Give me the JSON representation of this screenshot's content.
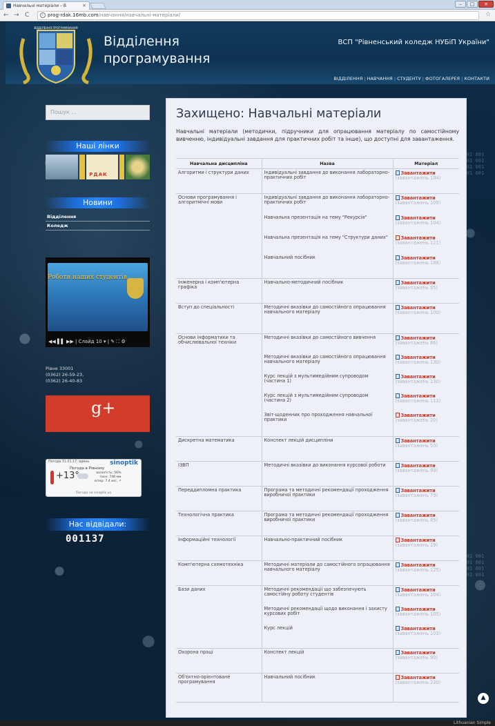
{
  "browser": {
    "tab_title": "Навчальні матеріали – В",
    "tab_close": "×",
    "url_host": "prog-rdak.16mb.com",
    "url_path": "/навчання/навчальні-матеріали/",
    "back": "←",
    "forward": "→",
    "reload": "C",
    "star": "☆"
  },
  "header": {
    "site_title_line1": "Відділення",
    "site_title_line2": "програмування",
    "college": "ВСП \"Рівненський коледж НУБіП України\"",
    "nav": [
      "ВІДДІЛЕННЯ",
      "НАВЧАННЯ",
      "СТУДЕНТУ",
      "ФОТОГАЛЕРЕЯ",
      "КОНТАКТИ"
    ],
    "logo_text": "ВІДДІЛЕННЯ ПРОГРАМУВАННЯ"
  },
  "sidebar": {
    "search_placeholder": "Пошук ...",
    "links_title": "Наші лінки",
    "links_logo_text": "РДАК",
    "news_title": "Новини",
    "news_items": [
      "Відділення",
      "Коледж"
    ],
    "video_slide_text": "Роботи наших студентів",
    "video_controls": "◀◀  ▌▌  ▶▶  | Слайд 10 ▾ |  ✎  ⛶  ⚙",
    "address_lines": [
      "Рівне 33001",
      "(0362) 26-59-23,",
      "(0362) 26-40-83"
    ],
    "gplus_label": "g+",
    "weather": {
      "header": "Погода 31.01.17, вдень",
      "brand": "sinoptik",
      "city": "Погода в Рівному",
      "temp": "+13°",
      "details": "вологість: 56%\nтиск: 748 мм\nвітер: 7.4 м/с, ↗",
      "footer": "Погода на sinoptik.ua"
    },
    "visits_title": "Нас відвідали:",
    "visits_count": "001137"
  },
  "content": {
    "title": "Захищено: Навчальні матеріали",
    "intro": "Навчальні матеріали (методички, підручники для опрацювання матеріалу по самостійному вивченню, індивідуальні завдання для практичних робіт та інше), що доступні для завантаження.",
    "columns": [
      "Навчальна дисципліна",
      "Назва",
      "Матеріал"
    ],
    "download_label": "Завантажити",
    "rows": [
      {
        "discipline": "Алгоритми і структури даних",
        "items": [
          {
            "title": "Індивідуальні завдання до виконання лабораторно-практичних робіт",
            "count": "(завантажень 194)",
            "icon": "word"
          }
        ]
      },
      {
        "discipline": "Основи програмування і алгоритмічні мови",
        "items": [
          {
            "title": "Індивідуальні завдання до виконання лабораторно-практичних робіт",
            "count": "(завантажень 109)",
            "icon": "word"
          },
          {
            "title": "Навчальна презентація на тему \"Рекурсія\"",
            "count": "(завантажень 104)",
            "icon": "word"
          },
          {
            "title": "Навчальна презентація на тему \"Структури даних\"",
            "count": "(завантажень 121)",
            "icon": "ppt"
          },
          {
            "title": "Навчальний посібник",
            "count": "(завантажень 188)",
            "icon": "word"
          }
        ]
      },
      {
        "discipline": "Інженерна і комп'ютерна графіка",
        "items": [
          {
            "title": "Навчально-методичний посібник",
            "count": "(завантажень 95)",
            "icon": "word"
          }
        ]
      },
      {
        "discipline": "Вступ до спеціальності",
        "items": [
          {
            "title": "Методичні вказівки до самостійного опрацювання навчального матеріалу",
            "count": "(завантажень 100)",
            "icon": "word"
          }
        ]
      },
      {
        "discipline": "Основи інформатики та обчислювальної техніки",
        "items": [
          {
            "title": "Методичні вказівки до самостійного вивчення",
            "count": "(завантажень 86)",
            "icon": "word"
          },
          {
            "title": "Методичні вказівки до самостійного опрацювання навчального матеріалу",
            "count": "(завантажень 130)",
            "icon": "word"
          },
          {
            "title": "Курс лекцій з мультимедійним супроводом (частина 1)",
            "count": "(завантажень 130)",
            "icon": "word"
          },
          {
            "title": "Курс лекцій з мультимедійним супроводом (частина 2)",
            "count": "(завантажень 113)",
            "icon": "word"
          },
          {
            "title": "Звіт-щоденник про проходження навчальної практики",
            "count": "(завантажень 20)",
            "icon": "pdf"
          }
        ]
      },
      {
        "discipline": "Дискретна математика",
        "items": [
          {
            "title": "Конспект лекцій дисципліни",
            "count": "(завантажень 53)",
            "icon": "word"
          }
        ]
      },
      {
        "discipline": "ІЗВП",
        "items": [
          {
            "title": "Методичні вказівки до виконання курсової роботи",
            "count": "(завантажень 99)",
            "icon": "word"
          }
        ]
      },
      {
        "discipline": "Переддипломна практика",
        "items": [
          {
            "title": "Програма та методичні рекомендації проходження виробничої практики",
            "count": "(завантажень 79)",
            "icon": "word"
          }
        ]
      },
      {
        "discipline": "Технологічна практика",
        "items": [
          {
            "title": "Програма та методичні рекомендації проходження виробничої практики",
            "count": "(завантажень 85)",
            "icon": "word"
          }
        ]
      },
      {
        "discipline": "Інформаційні технології",
        "items": [
          {
            "title": "Навчально-практичний посібник",
            "count": "(завантажень 19)",
            "icon": "pdf"
          }
        ]
      },
      {
        "discipline": "Комп'ютерна схемотехніка",
        "items": [
          {
            "title": "Методичні матеріали до самостійного опрацювання навчального матеріалу",
            "count": "(завантажень 125)",
            "icon": "word"
          }
        ]
      },
      {
        "discipline": "Бази даних",
        "items": [
          {
            "title": "Методичні рекомендації що забезпечують самостійну роботу студентів",
            "count": "(завантажень 104)",
            "icon": "word"
          },
          {
            "title": "Методичні рекомендації щодо виконання і захисту курсових робіт",
            "count": "(завантажень 105)",
            "icon": "word"
          },
          {
            "title": "Курс лекцій",
            "count": "(завантажень 103)",
            "icon": "word"
          }
        ]
      },
      {
        "discipline": "Охорона праці",
        "items": [
          {
            "title": "Конспект лекцій",
            "count": "(завантажень 90)",
            "icon": "word"
          }
        ]
      },
      {
        "discipline": "Об'єктно-орієнтоване програмування",
        "items": [
          {
            "title": "Навчальний посібник",
            "count": "(завантажень 230)",
            "icon": "pdf"
          }
        ]
      }
    ]
  },
  "footer_text": "Lithuanian Simple",
  "scroll_top": "▲"
}
